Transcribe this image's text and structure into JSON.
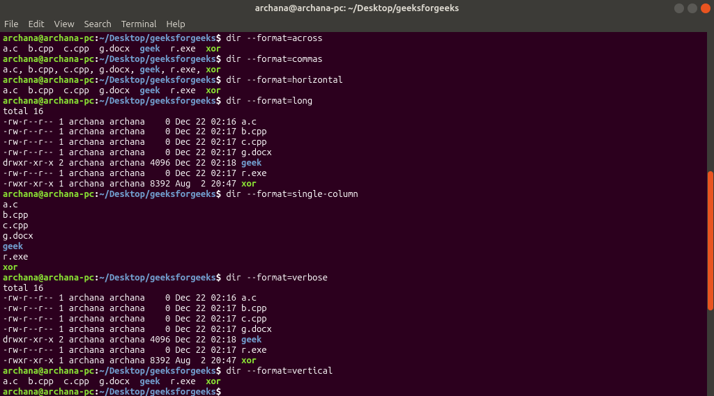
{
  "titlebar": {
    "title": "archana@archana-pc: ~/Desktop/geeksforgeeks"
  },
  "menubar": {
    "file": "File",
    "edit": "Edit",
    "view": "View",
    "search": "Search",
    "terminal": "Terminal",
    "help": "Help"
  },
  "prompt": {
    "user": "archana@archana-pc",
    "colon": ":",
    "path": "~/Desktop/geeksforgeeks",
    "dollar": "$"
  },
  "commands": {
    "cmd1": " dir --format=across",
    "cmd2": " dir --format=commas",
    "cmd3": " dir --format=horizontal",
    "cmd4": " dir --format=long",
    "cmd5": " dir --format=single-column",
    "cmd6": " dir --format=verbose",
    "cmd7": " dir --format=vertical",
    "cmd8": " "
  },
  "output": {
    "across_files": "a.c  b.cpp  c.cpp  g.docx  ",
    "across_geek": "geek",
    "across_rexe": "  r.exe  ",
    "across_xor": "xor",
    "commas_line": "a.c, b.cpp, c.cpp, g.docx, ",
    "commas_geek": "geek",
    "commas_rest": ", r.exe, ",
    "commas_xor": "xor",
    "total": "total 16",
    "long1": "-rw-r--r-- 1 archana archana    0 Dec 22 02:16 a.c",
    "long2": "-rw-r--r-- 1 archana archana    0 Dec 22 02:17 b.cpp",
    "long3": "-rw-r--r-- 1 archana archana    0 Dec 22 02:17 c.cpp",
    "long4": "-rw-r--r-- 1 archana archana    0 Dec 22 02:17 g.docx",
    "long5_pre": "drwxr-xr-x 2 archana archana 4096 Dec 22 02:18 ",
    "long5_dir": "geek",
    "long6": "-rw-r--r-- 1 archana archana    0 Dec 22 02:17 r.exe",
    "long7_pre": "-rwxr-xr-x 1 archana archana 8392 Aug  2 20:47 ",
    "long7_exec": "xor",
    "sc1": "a.c",
    "sc2": "b.cpp",
    "sc3": "c.cpp",
    "sc4": "g.docx",
    "sc5": "geek",
    "sc6": "r.exe",
    "sc7": "xor"
  }
}
